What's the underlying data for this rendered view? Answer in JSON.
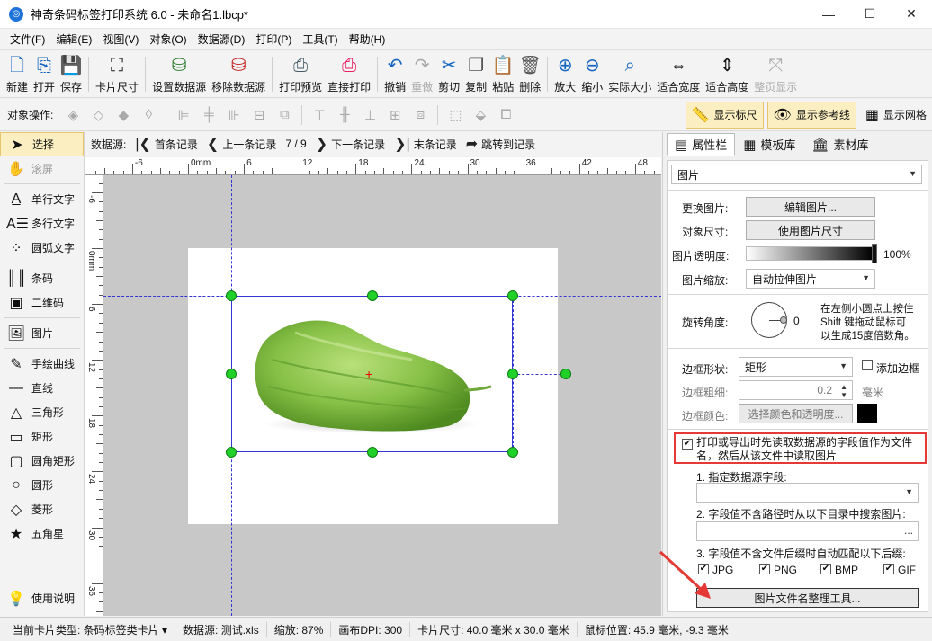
{
  "window": {
    "title": "神奇条码标签打印系统 6.0 - 未命名1.lbcp*",
    "minimize": "—",
    "maximize": "☐",
    "close": "✕"
  },
  "menu": [
    "文件(F)",
    "编辑(E)",
    "视图(V)",
    "对象(O)",
    "数据源(D)",
    "打印(P)",
    "工具(T)",
    "帮助(H)"
  ],
  "toolbar": {
    "new": "新建",
    "open": "打开",
    "save": "保存",
    "card_size": "卡片尺寸",
    "set_datasource": "设置数据源",
    "remove_datasource": "移除数据源",
    "print_preview": "打印预览",
    "direct_print": "直接打印",
    "undo": "撤销",
    "redo": "重做",
    "cut": "剪切",
    "copy": "复制",
    "paste": "粘贴",
    "delete": "删除",
    "zoom_in": "放大",
    "zoom_out": "缩小",
    "actual_size": "实际大小",
    "fit_width": "适合宽度",
    "fit_height": "适合高度",
    "full_page": "整页显示"
  },
  "ops": {
    "label": "对象操作:",
    "show_ruler": "显示标尺",
    "show_guides": "显示参考线",
    "show_grid": "显示网格"
  },
  "tools": {
    "select": "选择",
    "scroll": "滚屏",
    "single_text": "单行文字",
    "multi_text": "多行文字",
    "arc_text": "圆弧文字",
    "barcode": "条码",
    "qrcode": "二维码",
    "image": "图片",
    "freehand": "手绘曲线",
    "line": "直线",
    "triangle": "三角形",
    "rect": "矩形",
    "round_rect": "圆角矩形",
    "circle": "圆形",
    "diamond": "菱形",
    "star": "五角星",
    "help": "使用说明"
  },
  "records": {
    "label": "数据源:",
    "first": "首条记录",
    "prev": "上一条记录",
    "position": "7 / 9",
    "next": "下一条记录",
    "last": "末条记录",
    "jump": "跳转到记录"
  },
  "ruler": {
    "h_labels": [
      "-6",
      "0mm",
      "6",
      "12",
      "18",
      "24",
      "30",
      "36",
      "42",
      "48"
    ],
    "v_labels": [
      "-6",
      "0mm",
      "6",
      "12",
      "18",
      "24",
      "30",
      "36"
    ]
  },
  "panel": {
    "tabs": [
      "属性栏",
      "模板库",
      "素材库"
    ],
    "object_type": "图片",
    "replace_image_label": "更换图片:",
    "edit_image_btn": "编辑图片...",
    "object_size_label": "对象尺寸:",
    "use_image_size_btn": "使用图片尺寸",
    "transparency_label": "图片透明度:",
    "transparency_value": "100%",
    "scale_label": "图片缩放:",
    "scale_value": "自动拉伸图片",
    "rotation_label": "旋转角度:",
    "rotation_value": "0",
    "rotation_hint_1": "在左侧小圆点上按住",
    "rotation_hint_2": "Shift 键拖动鼠标可",
    "rotation_hint_3": "以生成15度倍数角。",
    "border_shape_label": "边框形状:",
    "border_shape_value": "矩形",
    "add_border_label": "添加边框",
    "border_width_label": "边框粗细:",
    "border_width_value": "0.2",
    "border_width_unit": "毫米",
    "border_color_label": "边框颜色:",
    "border_color_btn": "选择颜色和透明度...",
    "read_from_ds_label_1": "打印或导出时先读取数据源的字段值作为文件",
    "read_from_ds_label_2": "名，然后从该文件中读取图片",
    "step1": "1. 指定数据源字段:",
    "step2": "2. 字段值不含路径时从以下目录中搜索图片:",
    "browse_btn": "...",
    "step3": "3. 字段值不含文件后缀时自动匹配以下后缀:",
    "ext": [
      "JPG",
      "PNG",
      "BMP",
      "GIF"
    ],
    "organize_tool_btn": "图片文件名整理工具..."
  },
  "status": {
    "card_type": "当前卡片类型: 条码标签类卡片 ▾",
    "datasource": "数据源: 测试.xls",
    "zoom": "缩放: 87%",
    "dpi": "画布DPI: 300",
    "card_size": "卡片尺寸: 40.0 毫米 x 30.0 毫米",
    "mouse_pos": "鼠标位置: 45.9 毫米, -9.3 毫米"
  },
  "colors": {
    "accent_highlight": "#fbeec0",
    "handle_green": "#22d02a",
    "guide_blue": "#3535d0",
    "alert_red": "#e53935"
  }
}
